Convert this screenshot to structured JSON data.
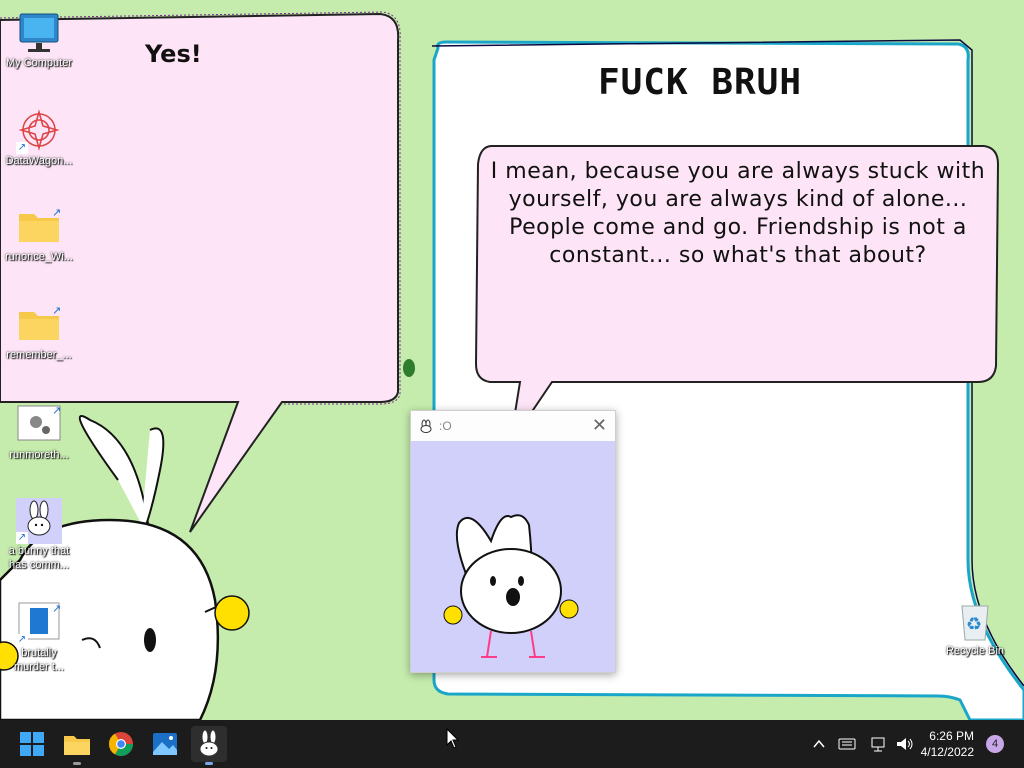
{
  "desktop": {
    "icons": [
      {
        "label": "My Computer",
        "icon": "monitor-icon"
      },
      {
        "label": "DataWagon...",
        "icon": "datawagon-icon"
      },
      {
        "label": "runonce_Wi...",
        "icon": "folder-icon"
      },
      {
        "label": "remember_...",
        "icon": "folder-icon"
      },
      {
        "label": "runmoreth...",
        "icon": "settings-app-icon"
      },
      {
        "label": "a bunny that\nhas comm...",
        "icon": "bunny-icon"
      },
      {
        "label": "brutally\nmurder t...",
        "icon": "document-icon"
      }
    ],
    "recycle_bin": {
      "label": "Recycle Bin",
      "icon": "recycle-bin-icon"
    }
  },
  "left_bubble": {
    "text": "Yes!"
  },
  "right_panel": {
    "title": "FUCK BRUH"
  },
  "speech_bubble": {
    "text": "I mean, because you are always stuck with yourself, you are always kind of alone... People come and go. Friendship is not a constant... so what's that about?"
  },
  "bunny_window": {
    "title": ":O",
    "close_glyph": "✕"
  },
  "taskbar": {
    "apps": [
      {
        "name": "start",
        "icon": "windows-start-icon"
      },
      {
        "name": "file-explorer",
        "icon": "file-explorer-icon"
      },
      {
        "name": "chrome",
        "icon": "chrome-icon"
      },
      {
        "name": "photos",
        "icon": "photos-icon"
      },
      {
        "name": "bunny-app",
        "icon": "bunny-icon"
      }
    ],
    "tray": {
      "chevron": "^",
      "keyboard": "⌨",
      "network": "🖧",
      "volume": "🔊"
    },
    "time": "6:26 PM",
    "date": "4/12/2022",
    "notification_count": "4"
  },
  "colors": {
    "desktop_bg": "#c5ecad",
    "bubble_pink": "#fde4f6",
    "bunny_bg": "#d0d0fb",
    "taskbar": "#1c1c1c",
    "yellow": "#ffe000"
  }
}
